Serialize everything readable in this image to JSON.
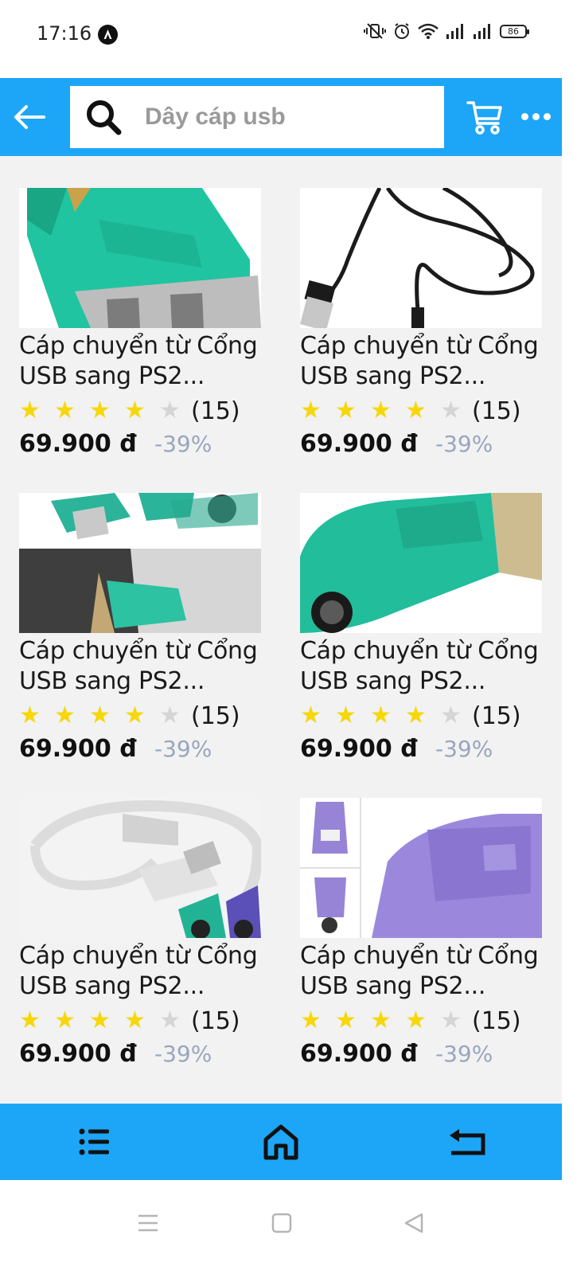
{
  "status_bar": {
    "time": "17:16",
    "battery": "86"
  },
  "header": {
    "search_text": "Dây cáp usb",
    "accent_color": "#1da6f7"
  },
  "products": [
    {
      "title_line1": "Cáp chuyển từ Cổng",
      "title_line2": "USB sang PS2...",
      "rating": 4,
      "reviews": "(15)",
      "price": "69.900 đ",
      "discount": "-39%"
    },
    {
      "title_line1": "Cáp chuyển từ Cổng",
      "title_line2": "USB sang PS2...",
      "rating": 4,
      "reviews": "(15)",
      "price": "69.900 đ",
      "discount": "-39%"
    },
    {
      "title_line1": "Cáp chuyển từ Cổng",
      "title_line2": "USB sang PS2...",
      "rating": 4,
      "reviews": "(15)",
      "price": "69.900 đ",
      "discount": "-39%"
    },
    {
      "title_line1": "Cáp chuyển từ Cổng",
      "title_line2": "USB sang PS2...",
      "rating": 4,
      "reviews": "(15)",
      "price": "69.900 đ",
      "discount": "-39%"
    },
    {
      "title_line1": "Cáp chuyển từ Cổng",
      "title_line2": "USB sang PS2...",
      "rating": 4,
      "reviews": "(15)",
      "price": "69.900 đ",
      "discount": "-39%"
    },
    {
      "title_line1": "Cáp chuyển từ Cổng",
      "title_line2": "USB sang PS2...",
      "rating": 4,
      "reviews": "(15)",
      "price": "69.900 đ",
      "discount": "-39%"
    }
  ],
  "icons": {
    "back": "arrow-left-icon",
    "search": "search-icon",
    "cart": "cart-icon",
    "more": "more-icon",
    "list": "list-icon",
    "home": "home-icon",
    "return": "return-icon"
  }
}
